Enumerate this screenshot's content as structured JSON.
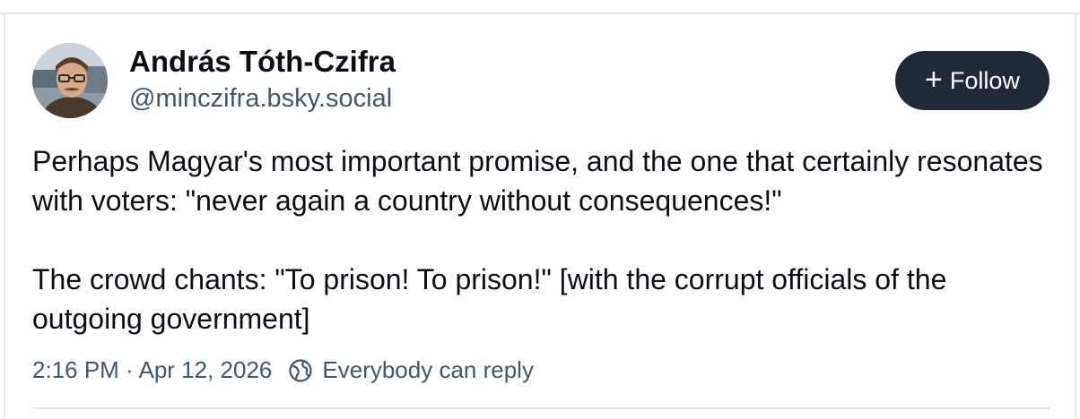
{
  "author": {
    "display_name": "András Tóth-Czifra",
    "handle": "@minczifra.bsky.social"
  },
  "follow_button": {
    "icon": "plus-icon",
    "label": "Follow"
  },
  "post": {
    "paragraphs": [
      "Perhaps Magyar's most important promise, and the one that certainly resonates with voters: \"never again a country without consequences!\"",
      "The crowd chants: \"To prison! To prison!\" [with the corrupt officials of the outgoing government]"
    ]
  },
  "meta": {
    "timestamp": "2:16 PM · Apr 12, 2026",
    "reply_setting_icon": "globe-icon",
    "reply_setting": "Everybody can reply"
  },
  "colors": {
    "name_text": "#0b0f14",
    "secondary_text": "#42576c",
    "follow_button_bg": "#1f2937",
    "border": "#e4e8ee"
  }
}
